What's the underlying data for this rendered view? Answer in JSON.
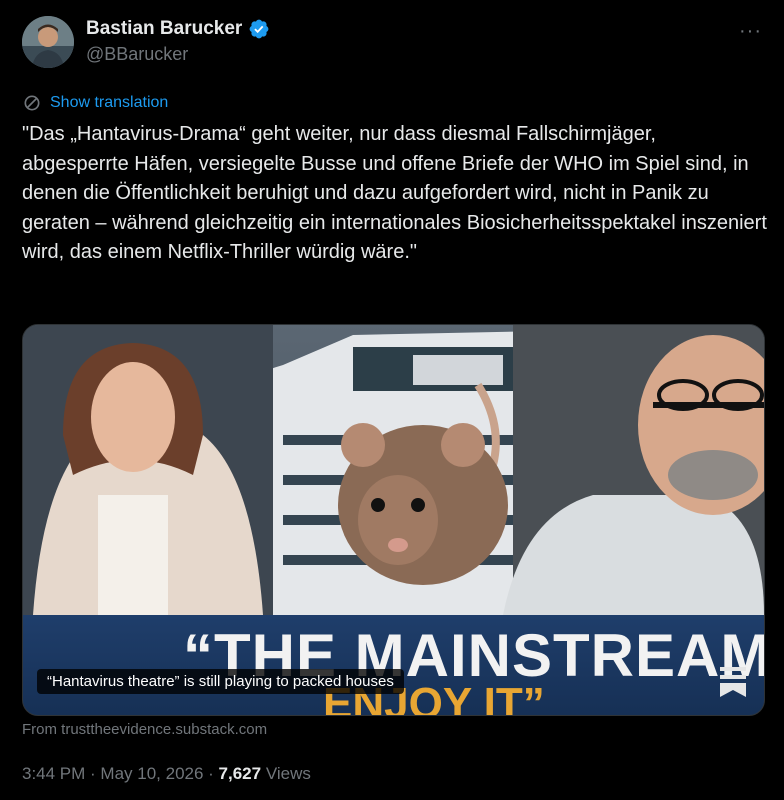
{
  "author": {
    "display_name": "Bastian Barucker",
    "handle": "@BBarucker",
    "verified": true
  },
  "menu": {
    "more_icon": "more-horizontal-icon",
    "more_label": "···"
  },
  "translation": {
    "label": "Show translation",
    "icon": "translate-icon"
  },
  "tweet": {
    "text": "\"Das „Hantavirus-Drama“ geht weiter, nur dass diesmal Fallschirmjäger, abgesperrte Häfen, versiegelte Busse und offene Briefe der WHO im Spiel sind, in denen die Öffentlichkeit beruhigt und dazu aufgefordert wird, nicht in Panik zu geraten – während gleichzeitig ein internationales Biosicherheitsspektakel inszeniert wird, das einem Netflix-Thriller würdig wäre.\""
  },
  "media": {
    "banner_line1": "“THE MAINSTREAM",
    "banner_line2": "ENJOY IT”",
    "caption": "“Hantavirus theatre” is still playing to packed houses"
  },
  "card": {
    "source": "From trusttheevidence.substack.com"
  },
  "meta": {
    "time": "3:44 PM",
    "separator": " · ",
    "date": "May 10, 2026",
    "views_count": "7,627",
    "views_label": " Views"
  },
  "colors": {
    "accent": "#1d9bf0",
    "muted": "#71767b",
    "text": "#e7e9ea",
    "background": "#000000"
  }
}
